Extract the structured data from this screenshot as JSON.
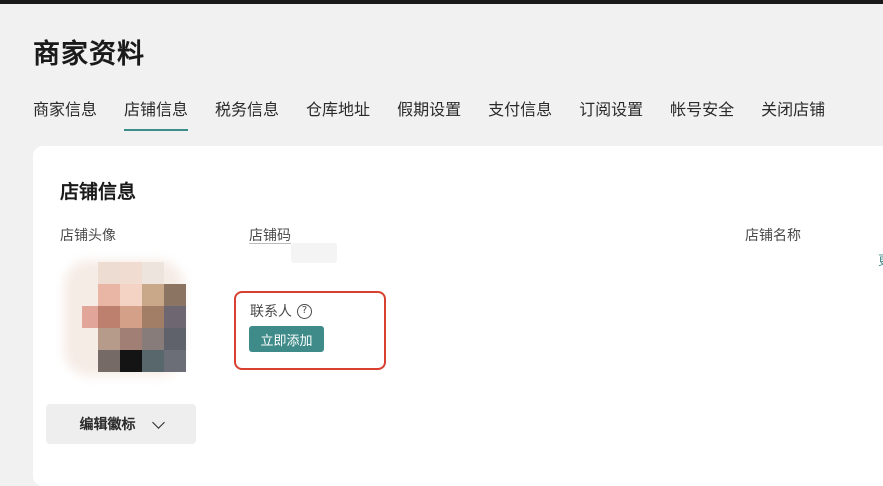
{
  "page": {
    "title": "商家资料"
  },
  "tabs": [
    {
      "label": "商家信息",
      "active": false
    },
    {
      "label": "店铺信息",
      "active": true
    },
    {
      "label": "税务信息",
      "active": false
    },
    {
      "label": "仓库地址",
      "active": false
    },
    {
      "label": "假期设置",
      "active": false
    },
    {
      "label": "支付信息",
      "active": false
    },
    {
      "label": "订阅设置",
      "active": false
    },
    {
      "label": "帐号安全",
      "active": false
    },
    {
      "label": "关闭店铺",
      "active": false
    }
  ],
  "store_info": {
    "section_title": "店铺信息",
    "avatar_label": "店铺头像",
    "store_code_label": "店铺码",
    "store_name_label": "店铺名称",
    "contact_label": "联系人",
    "add_now_label": "立即添加",
    "edit_logo_label": "编辑徽标",
    "right_link_text": "更"
  },
  "colors": {
    "accent": "#3e8b89",
    "highlight": "#d8412f",
    "page_background": "#f1f1f1",
    "card_background": "#ffffff"
  },
  "icons": {
    "help": "help-circle-icon",
    "dropdown": "chevron-down-icon"
  }
}
